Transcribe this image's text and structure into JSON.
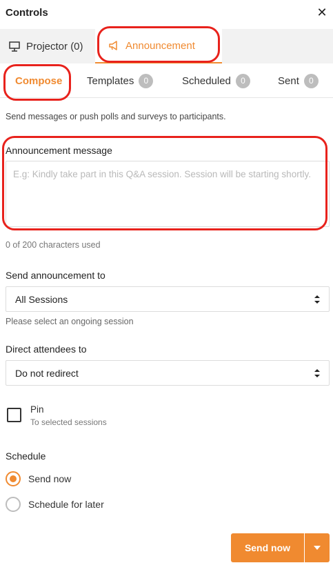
{
  "header": {
    "title": "Controls",
    "close_icon": "close-icon"
  },
  "top_tabs": [
    {
      "label": "Projector (0)",
      "icon": "projector-icon",
      "active": false
    },
    {
      "label": "Announcement",
      "icon": "megaphone-icon",
      "active": true
    }
  ],
  "sub_tabs": [
    {
      "label": "Compose",
      "count": null,
      "active": true
    },
    {
      "label": "Templates",
      "count": "0",
      "active": false
    },
    {
      "label": "Scheduled",
      "count": "0",
      "active": false
    },
    {
      "label": "Sent",
      "count": "0",
      "active": false
    }
  ],
  "compose": {
    "description": "Send messages or push polls and surveys to participants.",
    "message_label": "Announcement message",
    "message_placeholder": "E.g: Kindly take part in this Q&A session. Session will be starting shortly.",
    "message_value": "",
    "counter": "0 of 200 characters used",
    "send_to_label": "Send announcement to",
    "send_to_value": "All Sessions",
    "send_to_hint": "Please select an ongoing session",
    "direct_label": "Direct attendees to",
    "direct_value": "Do not redirect",
    "pin_label": "Pin",
    "pin_sub": "To selected sessions",
    "pin_checked": false,
    "schedule_label": "Schedule",
    "schedule_options": [
      {
        "label": "Send now",
        "checked": true
      },
      {
        "label": "Schedule for later",
        "checked": false
      }
    ],
    "send_button": "Send now"
  },
  "colors": {
    "accent": "#f08a30",
    "highlight": "#e8221c",
    "badge": "#bdbdbd"
  }
}
